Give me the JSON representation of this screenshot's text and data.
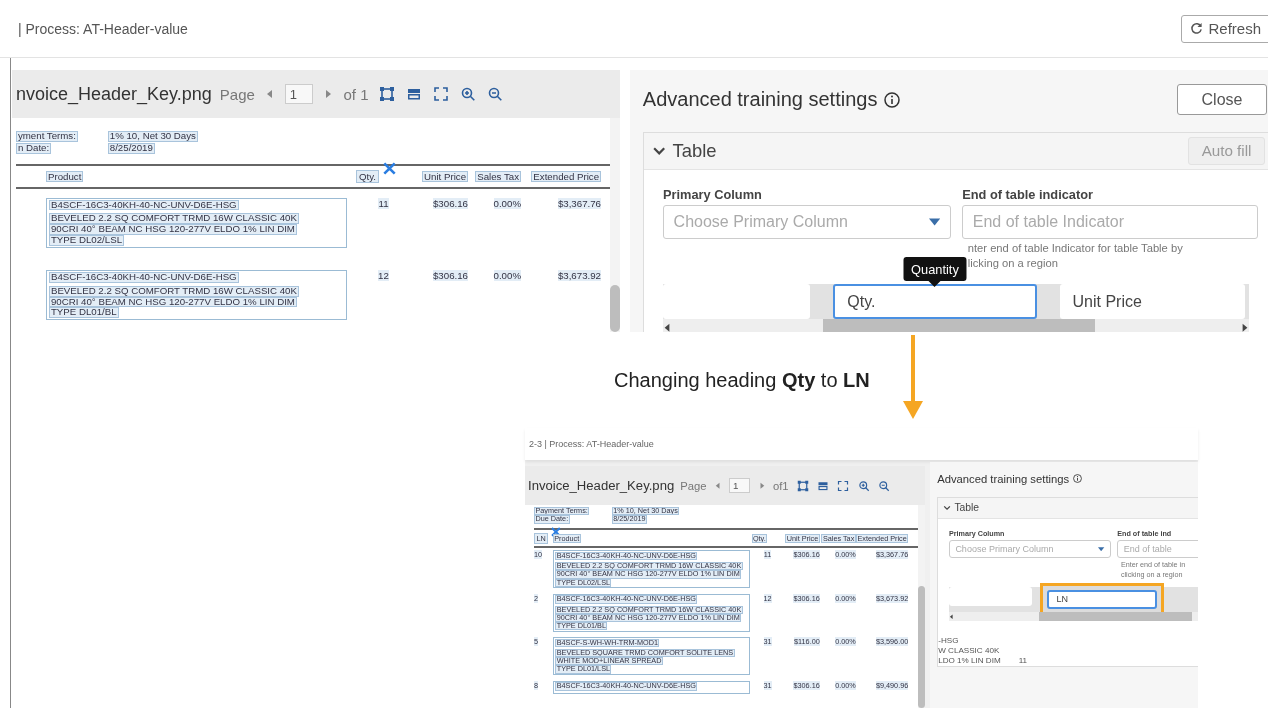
{
  "top_bar": {
    "title": "| Process: AT-Header-value",
    "refresh_button": "Refresh"
  },
  "main_view": {
    "document": {
      "file_name": "nvoice_Header_Key.png",
      "page_label": "Page",
      "page": "1",
      "page_count": "of 1",
      "fields": [
        {
          "label": "yment Terms:",
          "value": "1% 10, Net 30 Days"
        },
        {
          "label": "n Date:",
          "value": "8/25/2019"
        }
      ],
      "headers": [
        {
          "kind": "product",
          "text": "Product",
          "selected": false
        },
        {
          "kind": "qty",
          "text": "Qty.",
          "selected": true
        },
        {
          "kind": "unit_price",
          "text": "Unit Price",
          "selected": false
        },
        {
          "kind": "sales_tax",
          "text": "Sales Tax",
          "selected": false
        },
        {
          "kind": "extended_price",
          "text": "Extended Price",
          "selected": false
        }
      ],
      "rows": [
        {
          "product": "B4SCF-16C3-40KH-40-NC-UNV-D6E-HSG",
          "description": [
            "BEVELED 2.2 SQ COMFORT TRMD 16W CLASSIC 40K",
            "90CRI 40° BEAM NC HSG 120-277V ELDO 1% LIN DIM",
            "TYPE DL02/LSL"
          ],
          "qty": "11",
          "unit_price": "$306.16",
          "sales_tax": "0.00%",
          "extended_price": "$3,367.76"
        },
        {
          "product": "B4SCF-16C3-40KH-40-NC-UNV-D6E-HSG",
          "description": [
            "BEVELED 2.2 SQ COMFORT TRMD 16W CLASSIC 40K",
            "90CRI 40° BEAM NC HSG 120-277V ELDO 1% LIN DIM",
            "TYPE DL01/BL"
          ],
          "qty": "12",
          "unit_price": "$306.16",
          "sales_tax": "0.00%",
          "extended_price": "$3,673.92"
        }
      ]
    },
    "settings": {
      "title": "Advanced training settings",
      "close_button": "Close",
      "section": {
        "title": "Table",
        "expanded": true,
        "auto_fill_button": "Auto fill",
        "primary_column": {
          "label": "Primary Column",
          "placeholder": "Choose Primary Column"
        },
        "end_indicator": {
          "label": "End of table indicator",
          "placeholder": "End of table Indicator"
        },
        "hint": [
          "nter end of table Indicator for table Table by",
          "licking on a region"
        ],
        "headings": [
          {
            "focused": false
          },
          {
            "value": "Qty.",
            "focused": true,
            "tooltip": "Quantity"
          },
          {
            "value": "Unit Price",
            "focused": false
          }
        ]
      }
    }
  },
  "caption": "Changing heading **Qty** to **LN**",
  "inset": {
    "top_bar": {
      "title": "2-3 | Process: AT-Header-value"
    },
    "document": {
      "file_name": "Invoice_Header_Key.png",
      "page_label": "Page",
      "page": "1",
      "page_count": "of1",
      "fields": [
        {
          "label": "Payment Terms:",
          "value": "1% 10, Net 30 Days"
        },
        {
          "label": "Due Date:",
          "value": "8/25/2019"
        }
      ],
      "headers": [
        {
          "kind": "ln",
          "text": "LN",
          "selected": true
        },
        {
          "kind": "product",
          "text": "Product",
          "selected": false
        },
        {
          "kind": "qty",
          "text": "Qty.",
          "selected": false
        },
        {
          "kind": "unit_price",
          "text": "Unit Price",
          "selected": false
        },
        {
          "kind": "sales_tax",
          "text": "Sales Tax",
          "selected": false
        },
        {
          "kind": "extended_price",
          "text": "Extended Price",
          "selected": false
        }
      ],
      "rows": [
        {
          "ln": "10",
          "product": "B4SCF-16C3-40KH-40-NC-UNV-D6E-HSG",
          "description": [
            "BEVELED 2.2 SQ COMFORT TRMD 16W CLASSIC 40K",
            "90CRI 40° BEAM NC HSG 120-277V ELDO 1% LIN DIM",
            "TYPE DL02/LSL"
          ],
          "qty": "11",
          "unit_price": "$306.16",
          "sales_tax": "0.00%",
          "extended_price": "$3,367.76"
        },
        {
          "ln": "2",
          "product": "B4SCF-16C3-40KH-40-NC-UNV-D6E-HSG",
          "description": [
            "BEVELED 2.2 SQ COMFORT TRMD 16W CLASSIC 40K",
            "90CRI 40° BEAM NC HSG 120-277V ELDO 1% LIN DIM",
            "TYPE DL01/BL"
          ],
          "qty": "12",
          "unit_price": "$306.16",
          "sales_tax": "0.00%",
          "extended_price": "$3,673.92"
        },
        {
          "ln": "5",
          "product": "B4SCF-S-WH-WH-TRM-MOD1",
          "description": [
            "BEVELED SQUARE TRMD COMFORT SOLITE LENS",
            "WHITE MOD+LINEAR SPREAD",
            "TYPE DL01/LSL"
          ],
          "qty": "31",
          "unit_price": "$116.00",
          "sales_tax": "0.00%",
          "extended_price": "$3,596.00"
        },
        {
          "ln": "8",
          "product": "B4SCF-16C3-40KH-40-NC-UNV-D6E-HSG",
          "qty": "31",
          "unit_price": "$306.16",
          "sales_tax": "0.00%",
          "extended_price": "$9,490.96"
        }
      ]
    },
    "settings": {
      "title": "Advanced training settings",
      "section": {
        "title": "Table",
        "expanded": true,
        "primary_column": {
          "label": "Primary Column",
          "placeholder": "Choose Primary Column"
        },
        "end_indicator": {
          "label": "End of table ind",
          "placeholder": "End of table"
        },
        "hint": [
          "Enter end of table in",
          "clicking on a region"
        ],
        "headings": [
          {
            "focused": false
          },
          {
            "value": "LN",
            "focused": true,
            "highlighted": true
          }
        ],
        "preview": {
          "lines": [
            "-HSG",
            "W CLASSIC 40K",
            "LDO 1% LIN DIM"
          ],
          "qty": "11"
        }
      }
    }
  }
}
